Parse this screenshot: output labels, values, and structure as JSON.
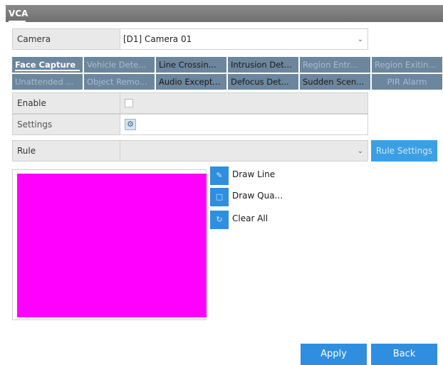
{
  "window": {
    "title": "VCA"
  },
  "camera": {
    "label": "Camera",
    "value": "[D1] Camera 01"
  },
  "tabs": [
    {
      "label": "Face Capture",
      "state": "active"
    },
    {
      "label": "Vehicle Dete...",
      "state": "disabled"
    },
    {
      "label": "Line Crossin...",
      "state": "normal"
    },
    {
      "label": "Intrusion Det...",
      "state": "normal"
    },
    {
      "label": "Region Entr...",
      "state": "disabled"
    },
    {
      "label": "Region Exitin...",
      "state": "disabled"
    },
    {
      "label": "Unattended ...",
      "state": "disabled"
    },
    {
      "label": "Object Remo...",
      "state": "disabled"
    },
    {
      "label": "Audio Except...",
      "state": "normal"
    },
    {
      "label": "Defocus Det...",
      "state": "normal"
    },
    {
      "label": "Sudden Scen...",
      "state": "normal"
    },
    {
      "label": "PIR Alarm",
      "state": "disabled"
    }
  ],
  "enable": {
    "label": "Enable",
    "checked": false
  },
  "settings": {
    "label": "Settings",
    "icon": "gear-icon"
  },
  "rule": {
    "label": "Rule",
    "value": "",
    "settings_button": "Rule Settings"
  },
  "draw_tools": [
    {
      "label": "Draw Line",
      "icon": "pencil-icon"
    },
    {
      "label": "Draw Qua...",
      "icon": "edit-square-icon"
    },
    {
      "label": "Clear All",
      "icon": "clear-icon"
    }
  ],
  "footer": {
    "apply_label": "Apply",
    "back_label": "Back"
  },
  "colors": {
    "accent": "#2f8ee0",
    "preview": "#ff00ff",
    "tab_bg": "#6c869e",
    "titlebar": "#7a7a7a"
  }
}
